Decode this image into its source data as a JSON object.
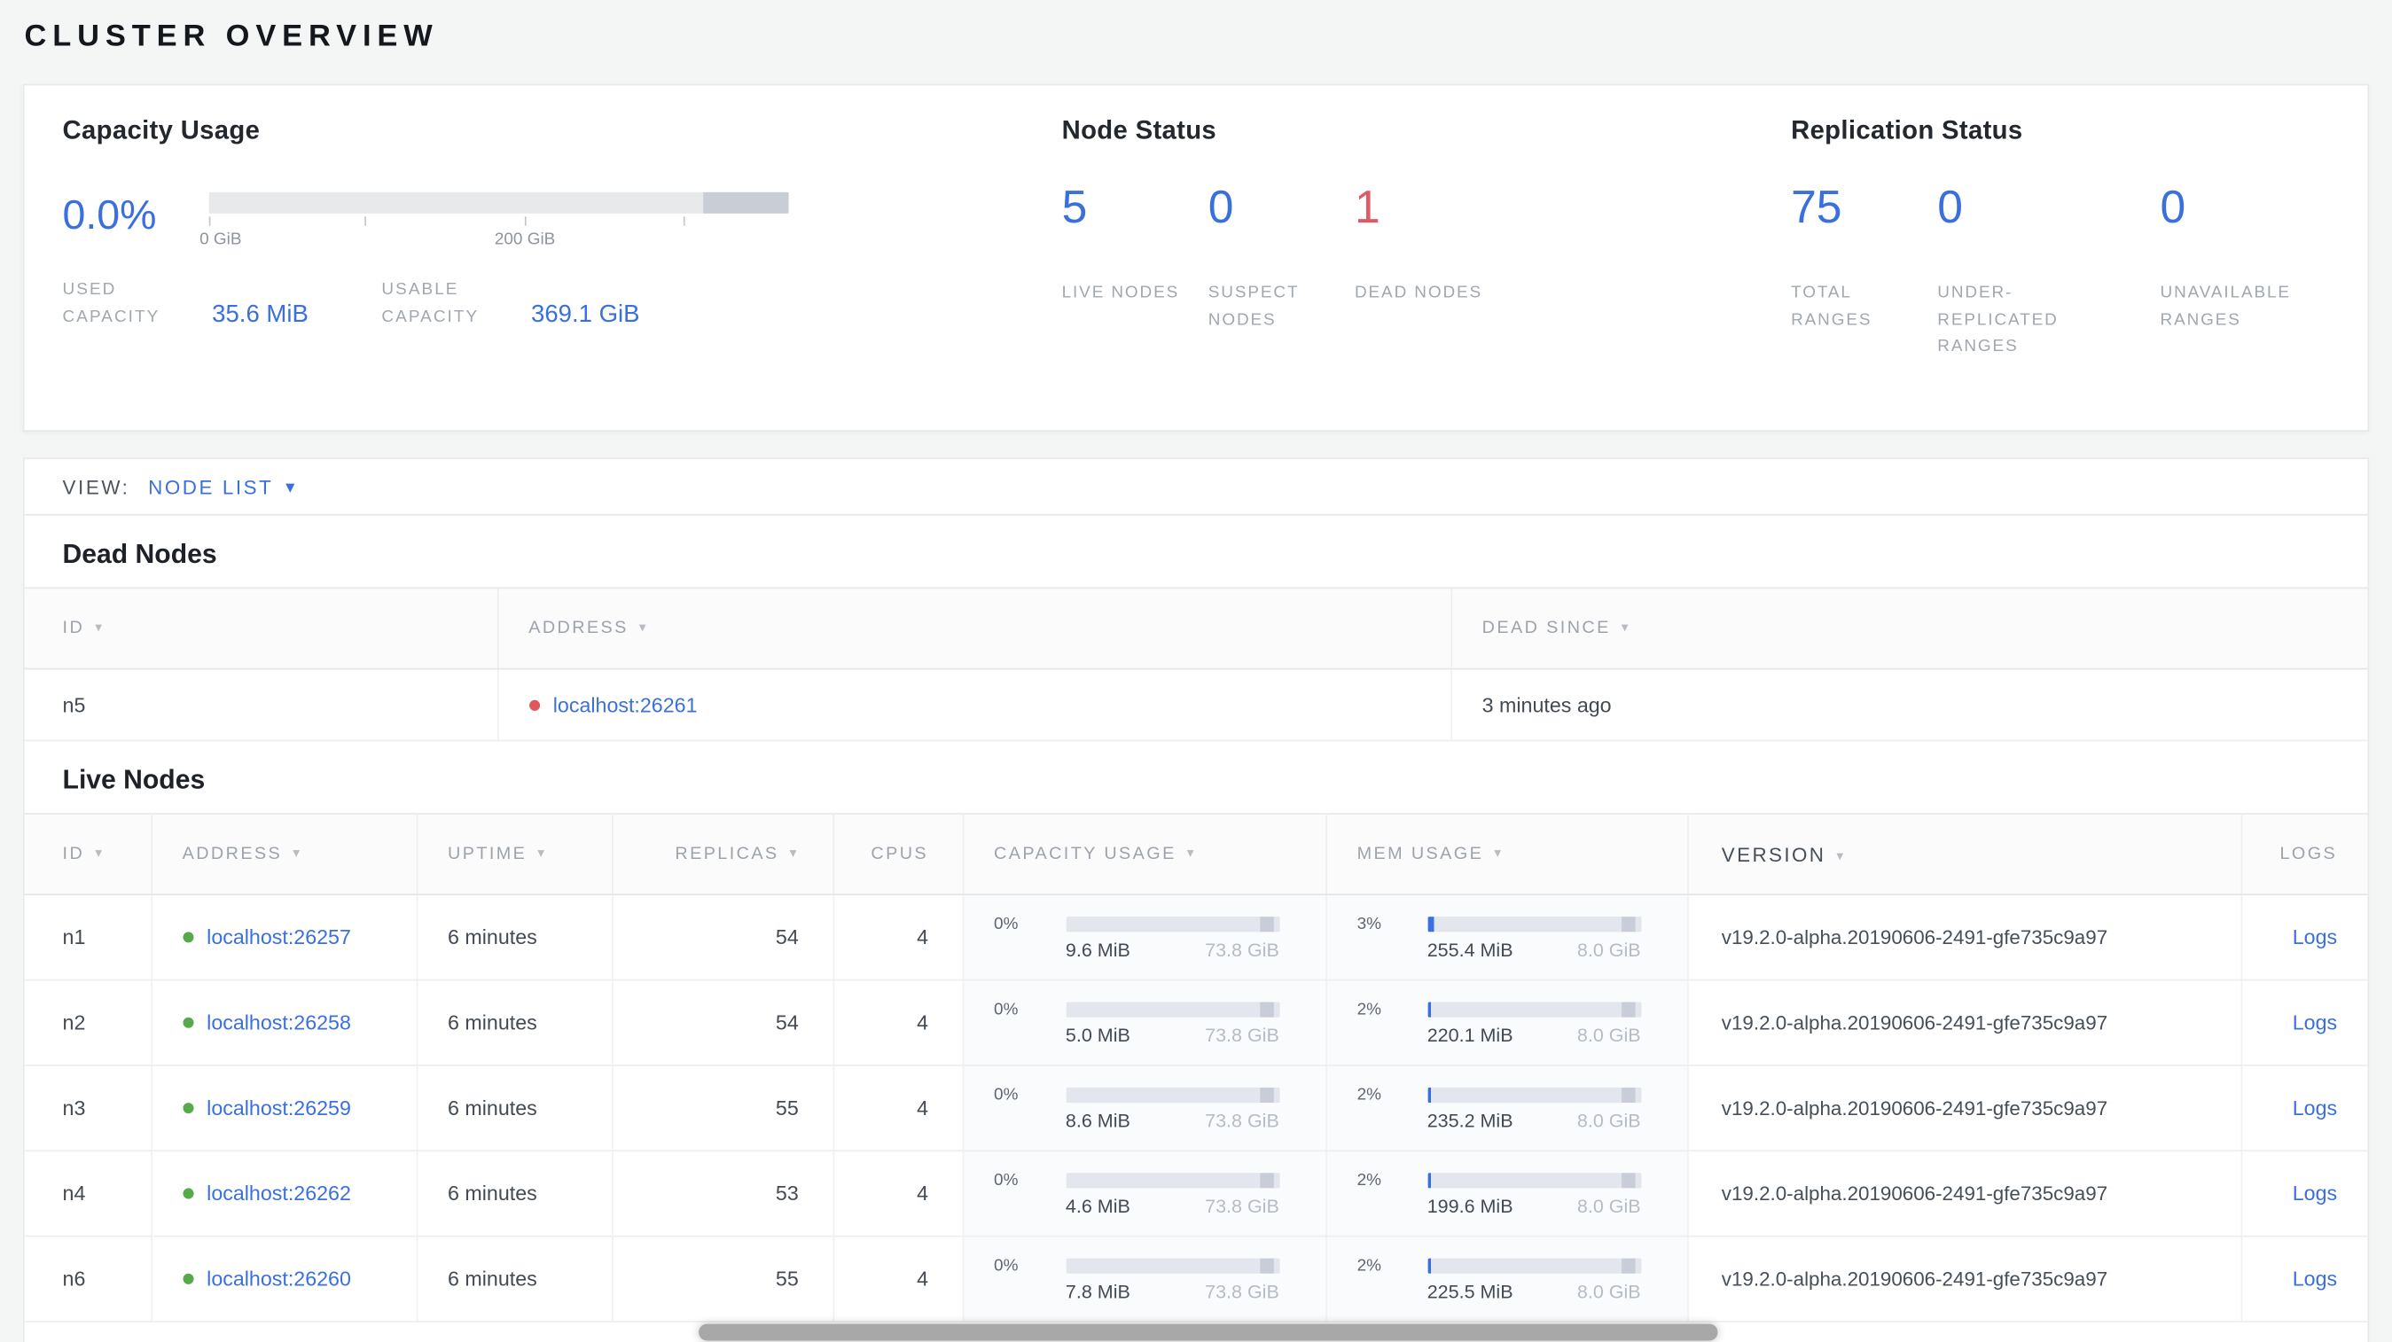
{
  "colors": {
    "accent_blue": "#3a70dd",
    "alert_red": "#e45763",
    "live_green": "#57aa49",
    "dead_red": "#e0565a"
  },
  "page": {
    "title": "CLUSTER OVERVIEW"
  },
  "summary": {
    "capacity": {
      "title": "Capacity Usage",
      "percent": "0.0%",
      "axis_ticks": [
        "0 GiB",
        "200 GiB"
      ],
      "stats": [
        {
          "label": "USED CAPACITY",
          "value": "35.6 MiB"
        },
        {
          "label": "USABLE CAPACITY",
          "value": "369.1 GiB"
        }
      ]
    },
    "node_status": {
      "title": "Node Status",
      "stats": [
        {
          "value": "5",
          "label": "LIVE NODES",
          "color": "#3a70dd"
        },
        {
          "value": "0",
          "label": "SUSPECT NODES",
          "color": "#3a70dd"
        },
        {
          "value": "1",
          "label": "DEAD NODES",
          "color": "#e45763"
        }
      ]
    },
    "replication": {
      "title": "Replication Status",
      "stats": [
        {
          "value": "75",
          "label": "TOTAL RANGES",
          "color": "#3a70dd"
        },
        {
          "value": "0",
          "label": "UNDER-REPLICATED RANGES",
          "color": "#3a70dd"
        },
        {
          "value": "0",
          "label": "UNAVAILABLE RANGES",
          "color": "#3a70dd"
        }
      ]
    }
  },
  "view_bar": {
    "label": "VIEW:",
    "selected": "NODE LIST"
  },
  "dead_nodes": {
    "title": "Dead Nodes",
    "columns": [
      "ID",
      "ADDRESS",
      "DEAD SINCE"
    ],
    "rows": [
      {
        "id": "n5",
        "address": "localhost:26261",
        "dead_since": "3 minutes ago"
      }
    ]
  },
  "live_nodes": {
    "title": "Live Nodes",
    "columns": [
      "ID",
      "ADDRESS",
      "UPTIME",
      "REPLICAS",
      "CPUS",
      "CAPACITY USAGE",
      "MEM USAGE",
      "VERSION",
      "LOGS"
    ],
    "rows": [
      {
        "id": "n1",
        "address": "localhost:26257",
        "uptime": "6 minutes",
        "replicas": "54",
        "cpus": "4",
        "capacity": {
          "percent": "0%",
          "pct": 0,
          "used": "9.6 MiB",
          "total": "73.8 GiB"
        },
        "mem": {
          "percent": "3%",
          "pct": 3,
          "used": "255.4 MiB",
          "total": "8.0 GiB"
        },
        "version": "v19.2.0-alpha.20190606-2491-gfe735c9a97",
        "logs": "Logs"
      },
      {
        "id": "n2",
        "address": "localhost:26258",
        "uptime": "6 minutes",
        "replicas": "54",
        "cpus": "4",
        "capacity": {
          "percent": "0%",
          "pct": 0,
          "used": "5.0 MiB",
          "total": "73.8 GiB"
        },
        "mem": {
          "percent": "2%",
          "pct": 2,
          "used": "220.1 MiB",
          "total": "8.0 GiB"
        },
        "version": "v19.2.0-alpha.20190606-2491-gfe735c9a97",
        "logs": "Logs"
      },
      {
        "id": "n3",
        "address": "localhost:26259",
        "uptime": "6 minutes",
        "replicas": "55",
        "cpus": "4",
        "capacity": {
          "percent": "0%",
          "pct": 0,
          "used": "8.6 MiB",
          "total": "73.8 GiB"
        },
        "mem": {
          "percent": "2%",
          "pct": 2,
          "used": "235.2 MiB",
          "total": "8.0 GiB"
        },
        "version": "v19.2.0-alpha.20190606-2491-gfe735c9a97",
        "logs": "Logs"
      },
      {
        "id": "n4",
        "address": "localhost:26262",
        "uptime": "6 minutes",
        "replicas": "53",
        "cpus": "4",
        "capacity": {
          "percent": "0%",
          "pct": 0,
          "used": "4.6 MiB",
          "total": "73.8 GiB"
        },
        "mem": {
          "percent": "2%",
          "pct": 2,
          "used": "199.6 MiB",
          "total": "8.0 GiB"
        },
        "version": "v19.2.0-alpha.20190606-2491-gfe735c9a97",
        "logs": "Logs"
      },
      {
        "id": "n6",
        "address": "localhost:26260",
        "uptime": "6 minutes",
        "replicas": "55",
        "cpus": "4",
        "capacity": {
          "percent": "0%",
          "pct": 0,
          "used": "7.8 MiB",
          "total": "73.8 GiB"
        },
        "mem": {
          "percent": "2%",
          "pct": 2,
          "used": "225.5 MiB",
          "total": "8.0 GiB"
        },
        "version": "v19.2.0-alpha.20190606-2491-gfe735c9a97",
        "logs": "Logs"
      }
    ]
  }
}
